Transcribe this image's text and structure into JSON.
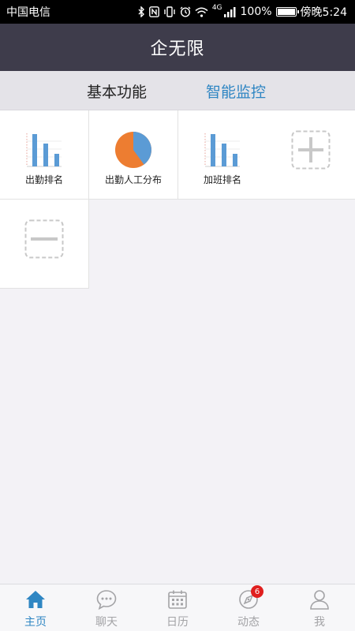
{
  "status_bar": {
    "carrier": "中国电信",
    "network_type": "4G",
    "battery": "100%",
    "time": "傍晚5:24"
  },
  "header": {
    "title": "企无限"
  },
  "tabs": [
    {
      "label": "基本功能"
    },
    {
      "label": "智能监控"
    }
  ],
  "tiles": [
    {
      "label": "出勤排名",
      "icon": "bar-chart-icon"
    },
    {
      "label": "出勤人工分布",
      "icon": "pie-chart-icon"
    },
    {
      "label": "加班排名",
      "icon": "bar-chart-icon"
    },
    {
      "label": "",
      "icon": "add-icon"
    },
    {
      "label": "",
      "icon": "remove-icon"
    }
  ],
  "bottom_nav": [
    {
      "label": "主页",
      "icon": "home-icon",
      "active": true
    },
    {
      "label": "聊天",
      "icon": "chat-icon"
    },
    {
      "label": "日历",
      "icon": "calendar-icon"
    },
    {
      "label": "动态",
      "icon": "compass-icon",
      "badge": "6"
    },
    {
      "label": "我",
      "icon": "person-icon"
    }
  ],
  "colors": {
    "header_bg": "#3e3c4b",
    "accent": "#2f86c3",
    "bar_blue": "#5b9bd5",
    "pie_orange": "#ed7d31",
    "badge_red": "#e01f1f"
  }
}
